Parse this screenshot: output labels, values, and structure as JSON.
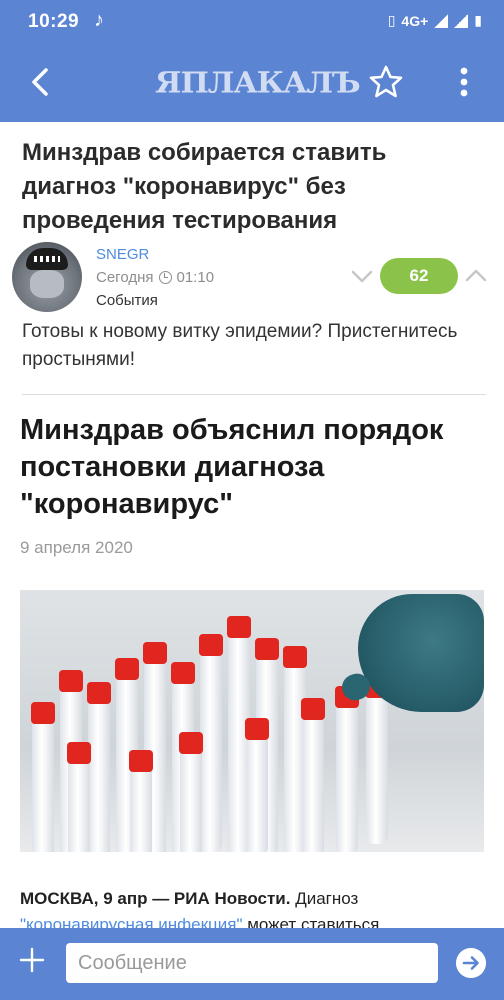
{
  "status_bar": {
    "time": "10:29",
    "network": "4G+"
  },
  "toolbar": {
    "logo_text": "ЯПЛАКАЛЪ",
    "back_icon": "arrow-left-icon",
    "favorite_icon": "star-icon",
    "menu_icon": "more-vert-icon"
  },
  "post": {
    "title": "Минздрав собирается ставить диагноз \"коронавирус\" без проведения тестирования",
    "author": "SNEGR",
    "day": "Сегодня",
    "time": "01:10",
    "category": "События",
    "rating": "62",
    "text": "Готовы к новому витку эпидемии? Пристегнитесь простынями!"
  },
  "article": {
    "title": "Минздрав объяснил порядок постановки диагноза \"коронавирус\"",
    "date": "9 апреля 2020",
    "lead_bold": "МОСКВА, 9 апр — РИА Новости.",
    "lead_text": "Диагноз",
    "lead_link": "\"коронавирусная инфекция\"",
    "lead_rest": "может ставиться"
  },
  "composer": {
    "placeholder": "Сообщение"
  },
  "colors": {
    "brand_blue": "#5b84d3",
    "rating_green": "#8bc34a",
    "link_blue": "#4f8be0"
  }
}
